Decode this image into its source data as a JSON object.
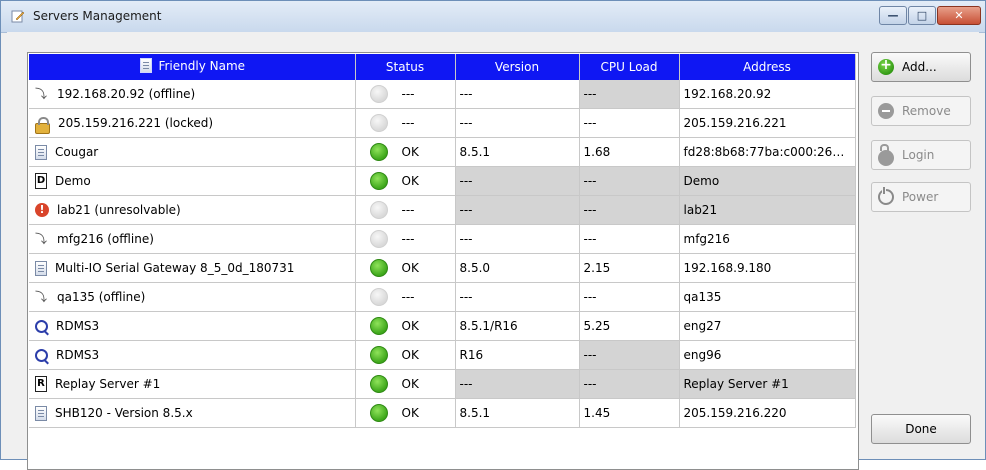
{
  "window": {
    "title": "Servers Management"
  },
  "table": {
    "columns": [
      "Friendly Name",
      "Status",
      "Version",
      "CPU Load",
      "Address"
    ],
    "rows": [
      {
        "icon": "plug-icon",
        "name": "192.168.20.92 (offline)",
        "status": "---",
        "online": false,
        "version": "---",
        "cpu": "---",
        "address": "192.168.20.92",
        "gray_version": false,
        "gray_cpu": true,
        "gray_address": false
      },
      {
        "icon": "lock-icon",
        "name": "205.159.216.221 (locked)",
        "status": "---",
        "online": false,
        "version": "---",
        "cpu": "---",
        "address": "205.159.216.221",
        "gray_version": false,
        "gray_cpu": false,
        "gray_address": false
      },
      {
        "icon": "server-icon",
        "name": "Cougar",
        "status": "OK",
        "online": true,
        "version": "8.5.1",
        "cpu": "1.68",
        "address": "fd28:8b68:77ba:c000:260...",
        "gray_version": false,
        "gray_cpu": false,
        "gray_address": false
      },
      {
        "icon": "demo-icon",
        "name": "Demo",
        "status": "OK",
        "online": true,
        "version": "---",
        "cpu": "---",
        "address": "Demo",
        "gray_version": true,
        "gray_cpu": true,
        "gray_address": true
      },
      {
        "icon": "error-icon",
        "name": "lab21 (unresolvable)",
        "status": "---",
        "online": false,
        "version": "---",
        "cpu": "---",
        "address": "lab21",
        "gray_version": true,
        "gray_cpu": true,
        "gray_address": true
      },
      {
        "icon": "plug-icon",
        "name": "mfg216 (offline)",
        "status": "---",
        "online": false,
        "version": "---",
        "cpu": "---",
        "address": "mfg216",
        "gray_version": false,
        "gray_cpu": false,
        "gray_address": false
      },
      {
        "icon": "server-icon",
        "name": "Multi-IO Serial Gateway 8_5_0d_180731",
        "status": "OK",
        "online": true,
        "version": "8.5.0",
        "cpu": "2.15",
        "address": "192.168.9.180",
        "gray_version": false,
        "gray_cpu": false,
        "gray_address": false
      },
      {
        "icon": "plug-icon",
        "name": "qa135 (offline)",
        "status": "---",
        "online": false,
        "version": "---",
        "cpu": "---",
        "address": "qa135",
        "gray_version": false,
        "gray_cpu": false,
        "gray_address": false
      },
      {
        "icon": "rdms-icon",
        "name": "RDMS3",
        "status": "OK",
        "online": true,
        "version": "8.5.1/R16",
        "cpu": "5.25",
        "address": "eng27",
        "gray_version": false,
        "gray_cpu": false,
        "gray_address": false
      },
      {
        "icon": "rdms-icon",
        "name": "RDMS3",
        "status": "OK",
        "online": true,
        "version": "R16",
        "cpu": "---",
        "address": "eng96",
        "gray_version": false,
        "gray_cpu": true,
        "gray_address": false
      },
      {
        "icon": "replay-icon",
        "name": "Replay Server #1",
        "status": "OK",
        "online": true,
        "version": "---",
        "cpu": "---",
        "address": "Replay Server #1",
        "gray_version": true,
        "gray_cpu": true,
        "gray_address": true
      },
      {
        "icon": "server-icon",
        "name": "SHB120 - Version 8.5.x",
        "status": "OK",
        "online": true,
        "version": "8.5.1",
        "cpu": "1.45",
        "address": "205.159.216.220",
        "gray_version": false,
        "gray_cpu": false,
        "gray_address": false
      }
    ]
  },
  "buttons": {
    "add": "Add...",
    "remove": "Remove",
    "login": "Login",
    "power": "Power",
    "done": "Done"
  },
  "colors": {
    "header_bg": "#0f17f3",
    "gray_cell": "#d4d4d4",
    "ok_green": "#3ea71b"
  }
}
